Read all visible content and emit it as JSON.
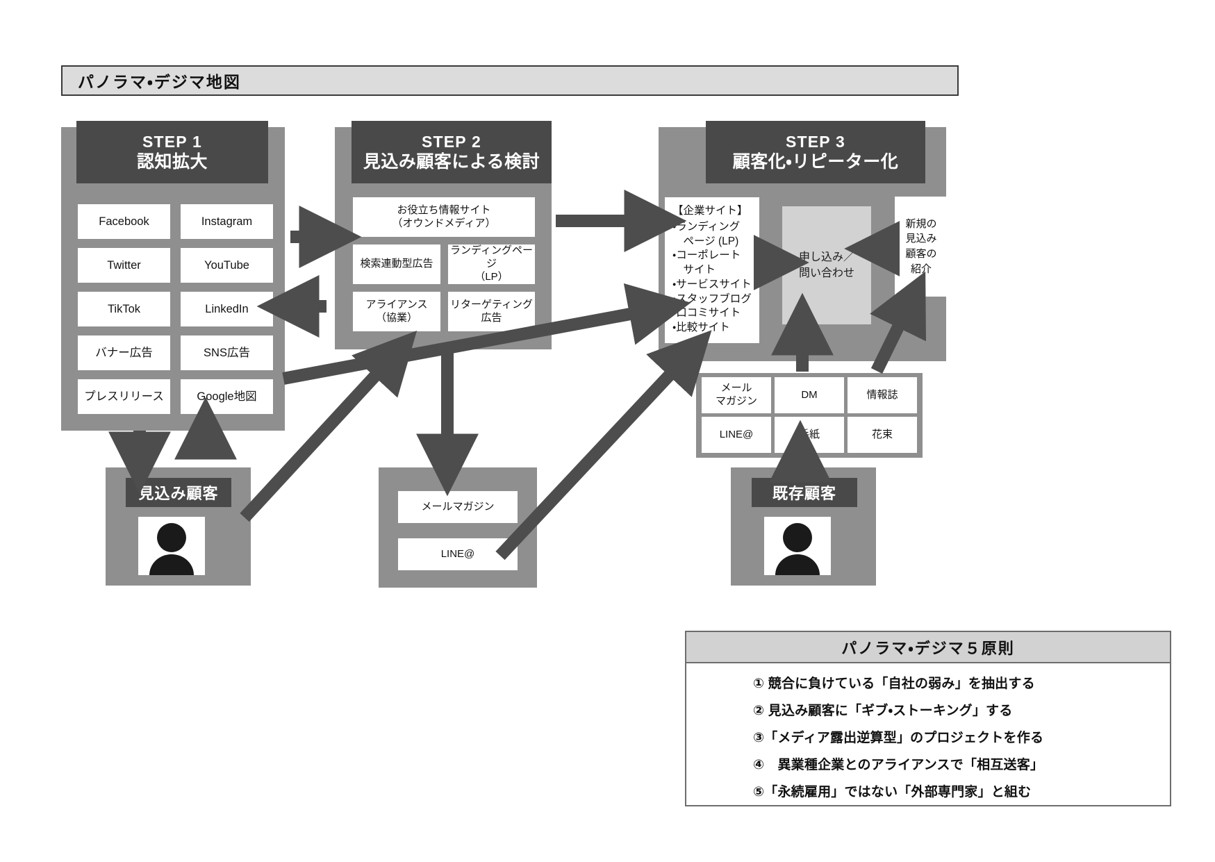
{
  "document": {
    "title": "パノラマ・デジマ地図"
  },
  "steps": [
    {
      "id": "step1",
      "number": "STEP 1",
      "name": "認知拡大",
      "items": [
        "Facebook",
        "Instagram",
        "Twitter",
        "YouTube",
        "TikTok",
        "LinkedIn",
        "バナー広告",
        "SNS広告",
        "プレスリリース",
        "Google地図"
      ]
    },
    {
      "id": "step2",
      "number": "STEP 2",
      "name": "見込み顧客による検討",
      "items": [
        "お役立ち情報サイト\n（オウンドメディア）",
        "検索連動型広告",
        "ランディングページ\n（LP）",
        "アライアンス\n（協業）",
        "リターゲティング\n広告"
      ]
    },
    {
      "id": "step3",
      "number": "STEP 3",
      "name": "顧客化・リピーター化",
      "corporate_site": {
        "heading": "【企業サイト】",
        "items": [
          "・ランディング\n 　ページ (LP)",
          "・コーポレート\n 　サイト",
          "・サービスサイト",
          "・スタッフブログ",
          "・口コミサイト",
          "・比較サイト"
        ]
      },
      "conversion_box": "申し込み／\n問い合わせ",
      "referral_box": "新規の\n見込み\n顧客の\n紹介",
      "retention_items": [
        "メール\nマガジン",
        "DM",
        "情報誌",
        "LINE@",
        "手紙",
        "花束"
      ]
    }
  ],
  "actors": {
    "prospect": {
      "label": "見込み顧客",
      "icon": "person-icon"
    },
    "existing": {
      "label": "既存顧客",
      "icon": "person-icon"
    }
  },
  "nurture": {
    "items": [
      "メールマガジン",
      "LINE@"
    ]
  },
  "principles": {
    "title": "パノラマ・デジマ５原則",
    "items": [
      "① 競合に負けている「自社の弱み」を抽出する",
      "② 見込み顧客に「ギブ・ストーキング」する",
      "③「メディア露出逆算型」のプロジェクトを作る",
      "④　異業種企業とのアライアンスで「相互送客」",
      "⑤「永続雇用」ではない「外部専門家」と組む"
    ]
  },
  "colors": {
    "panel_grey": "#8f8f8f",
    "header_dark": "#494949",
    "light_grey": "#d2d2d2",
    "arrow": "#4d4d4d",
    "white": "#ffffff"
  }
}
